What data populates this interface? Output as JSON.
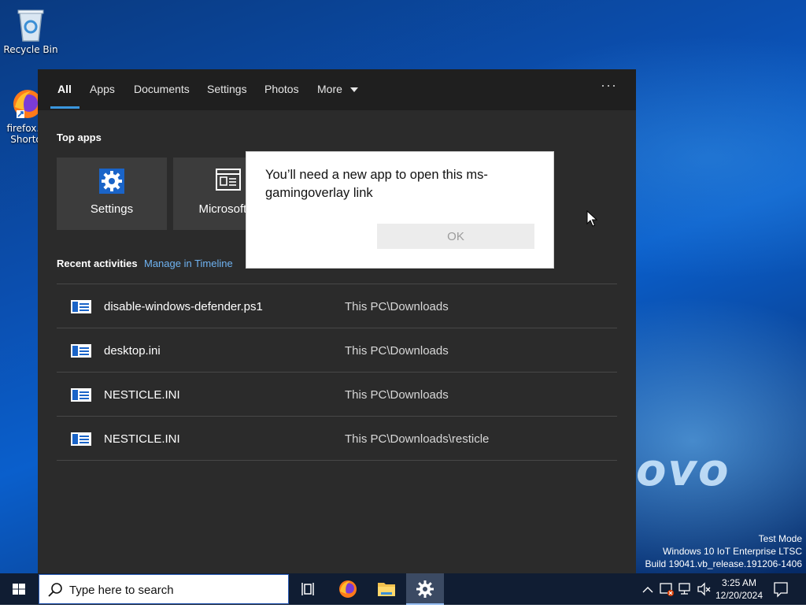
{
  "desktop": {
    "icons": [
      {
        "label": "Recycle Bin"
      },
      {
        "label_line1": "firefox.e",
        "label_line2": "Shorto"
      }
    ],
    "brand_text": "ovo",
    "watermark": {
      "line1": "Test Mode",
      "line2": "Windows 10 IoT Enterprise LTSC",
      "line3": "Build 19041.vb_release.191206-1406"
    }
  },
  "search_panel": {
    "tabs": [
      {
        "label": "All",
        "active": true
      },
      {
        "label": "Apps"
      },
      {
        "label": "Documents"
      },
      {
        "label": "Settings"
      },
      {
        "label": "Photos"
      },
      {
        "label": "More"
      }
    ],
    "more_options": "···",
    "top_apps_title": "Top apps",
    "top_apps": [
      {
        "label": "Settings",
        "icon": "gear-icon"
      },
      {
        "label": "Microsoft E",
        "icon": "browser-window-icon"
      }
    ],
    "recent_title": "Recent activities",
    "manage_link": "Manage in Timeline",
    "recent_items": [
      {
        "name": "disable-windows-defender.ps1",
        "path": "This PC\\Downloads"
      },
      {
        "name": "desktop.ini",
        "path": "This PC\\Downloads"
      },
      {
        "name": "NESTICLE.INI",
        "path": "This PC\\Downloads"
      },
      {
        "name": "NESTICLE.INI",
        "path": "This PC\\Downloads\\resticle"
      }
    ]
  },
  "dialog": {
    "message": "You’ll need a new app to open this ms-gamingoverlay link",
    "ok_label": "OK"
  },
  "taskbar": {
    "search_placeholder": "Type here to search",
    "pinned": [
      "task-view-icon",
      "firefox-icon",
      "file-explorer-icon",
      "settings-gear-icon"
    ],
    "time": "3:25 AM",
    "date": "12/20/2024"
  },
  "colors": {
    "accent": "#3a96dd",
    "panel_bg": "#2b2b2b",
    "taskbar_bg": "#101d33",
    "link": "#6fb3f2"
  }
}
